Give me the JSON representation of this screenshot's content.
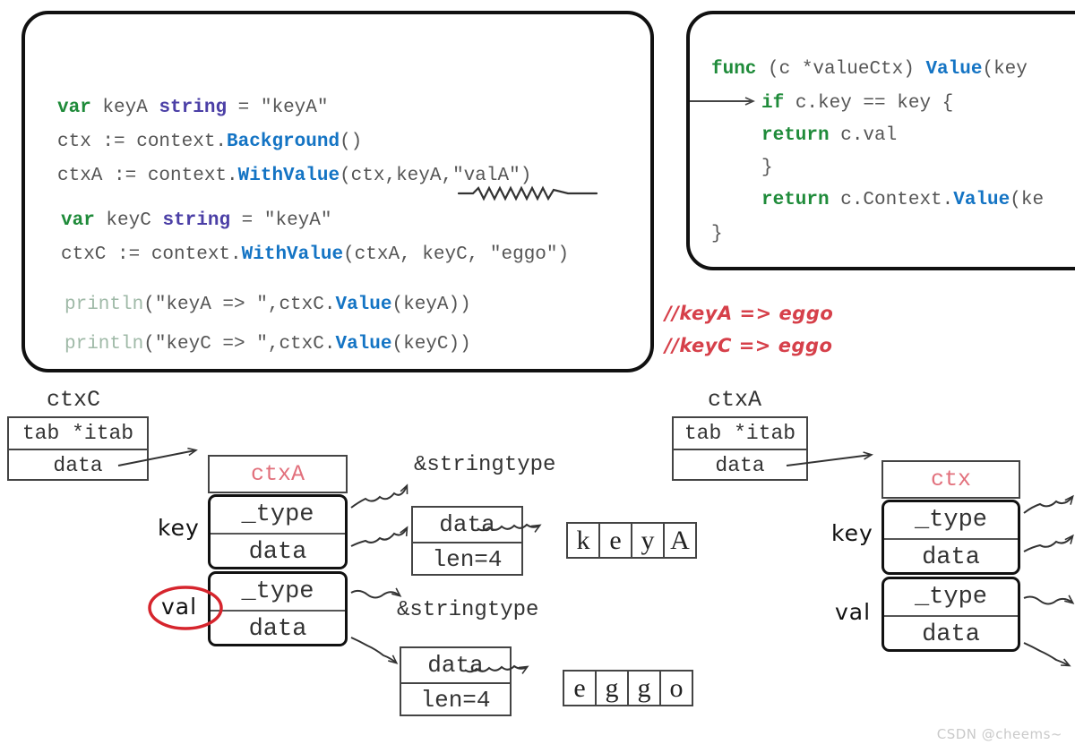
{
  "code_left": {
    "lines": [
      {
        "id": "l1",
        "tokens": [
          {
            "t": "var",
            "c": "kw-green"
          },
          {
            "t": " keyA ",
            "c": "plain"
          },
          {
            "t": "string",
            "c": "kw-purple"
          },
          {
            "t": " = \"keyA\"",
            "c": "plain"
          }
        ]
      },
      {
        "id": "l2",
        "tokens": [
          {
            "t": "ctx := context.",
            "c": "plain"
          },
          {
            "t": "Background",
            "c": "kw-blue"
          },
          {
            "t": "()",
            "c": "plain"
          }
        ]
      },
      {
        "id": "l3",
        "tokens": [
          {
            "t": "ctxA := context.",
            "c": "plain"
          },
          {
            "t": "WithValue",
            "c": "kw-blue"
          },
          {
            "t": "(ctx,keyA,\"valA\")",
            "c": "plain"
          }
        ]
      },
      {
        "id": "l4",
        "tokens": [
          {
            "t": "var",
            "c": "kw-green"
          },
          {
            "t": " keyC ",
            "c": "plain"
          },
          {
            "t": "string",
            "c": "kw-purple"
          },
          {
            "t": " = \"keyA\"",
            "c": "plain"
          }
        ]
      },
      {
        "id": "l5",
        "tokens": [
          {
            "t": "ctxC := context.",
            "c": "plain"
          },
          {
            "t": "WithValue",
            "c": "kw-blue"
          },
          {
            "t": "(ctxA, keyC, \"eggo\")",
            "c": "plain"
          }
        ]
      },
      {
        "id": "l6",
        "tokens": [
          {
            "t": "println",
            "c": "fn-pale"
          },
          {
            "t": "(\"keyA => \",ctxC.",
            "c": "plain"
          },
          {
            "t": "Value",
            "c": "kw-blue"
          },
          {
            "t": "(keyA))",
            "c": "plain"
          }
        ]
      },
      {
        "id": "l7",
        "tokens": [
          {
            "t": "println",
            "c": "fn-pale"
          },
          {
            "t": "(\"keyC => \",ctxC.",
            "c": "plain"
          },
          {
            "t": "Value",
            "c": "kw-blue"
          },
          {
            "t": "(keyC))",
            "c": "plain"
          }
        ]
      }
    ]
  },
  "code_right": {
    "lines": [
      {
        "id": "r1",
        "tokens": [
          {
            "t": "func",
            "c": "kw-green"
          },
          {
            "t": " (c *valueCtx) ",
            "c": "plain"
          },
          {
            "t": "Value",
            "c": "kw-blue"
          },
          {
            "t": "(key",
            "c": "plain"
          }
        ]
      },
      {
        "id": "r2",
        "tokens": [
          {
            "t": "if",
            "c": "kw-green"
          },
          {
            "t": " c.key == key {",
            "c": "plain"
          }
        ]
      },
      {
        "id": "r3",
        "tokens": [
          {
            "t": "return",
            "c": "kw-green"
          },
          {
            "t": " c.val",
            "c": "plain"
          }
        ]
      },
      {
        "id": "r4",
        "tokens": [
          {
            "t": "}",
            "c": "plain"
          }
        ]
      },
      {
        "id": "r5",
        "tokens": [
          {
            "t": "return",
            "c": "kw-green"
          },
          {
            "t": " c.Context.",
            "c": "plain"
          },
          {
            "t": "Value",
            "c": "kw-blue"
          },
          {
            "t": "(ke",
            "c": "plain"
          }
        ]
      },
      {
        "id": "r6",
        "tokens": [
          {
            "t": "}",
            "c": "plain"
          }
        ]
      }
    ]
  },
  "annotations": {
    "comment_1": "//keyA => eggo",
    "comment_2": "//keyC => eggo",
    "accent_red": "#d6404a",
    "accent_pink": "#e2707c",
    "accent_blue": "#1474c4",
    "accent_green": "#1f8b3a",
    "accent_purple": "#4b3fa6"
  },
  "diagram": {
    "ctxC": {
      "title": "ctxC",
      "rows": [
        "tab *itab",
        "data"
      ]
    },
    "ctxA_iface": {
      "title": "ctxA",
      "rows": [
        "tab *itab",
        "data"
      ]
    },
    "struct_left": {
      "header": "ctxA",
      "key_label": "key",
      "val_label": "val",
      "key_fields": [
        "_type",
        "data"
      ],
      "val_fields": [
        "_type",
        "data"
      ]
    },
    "struct_right": {
      "header": "ctx",
      "key_label": "key",
      "val_label": "val",
      "key_fields": [
        "_type",
        "data"
      ],
      "val_fields": [
        "_type",
        "data"
      ]
    },
    "stringtype_1": "&stringtype",
    "stringtype_2": "&stringtype",
    "strhdr_1": {
      "data": "data",
      "len": "len=4"
    },
    "strhdr_2": {
      "data": "data",
      "len": "len=4"
    },
    "bytes_1": [
      "k",
      "e",
      "y",
      "A"
    ],
    "bytes_2": [
      "e",
      "g",
      "g",
      "o"
    ]
  },
  "watermark": "CSDN @cheems~"
}
